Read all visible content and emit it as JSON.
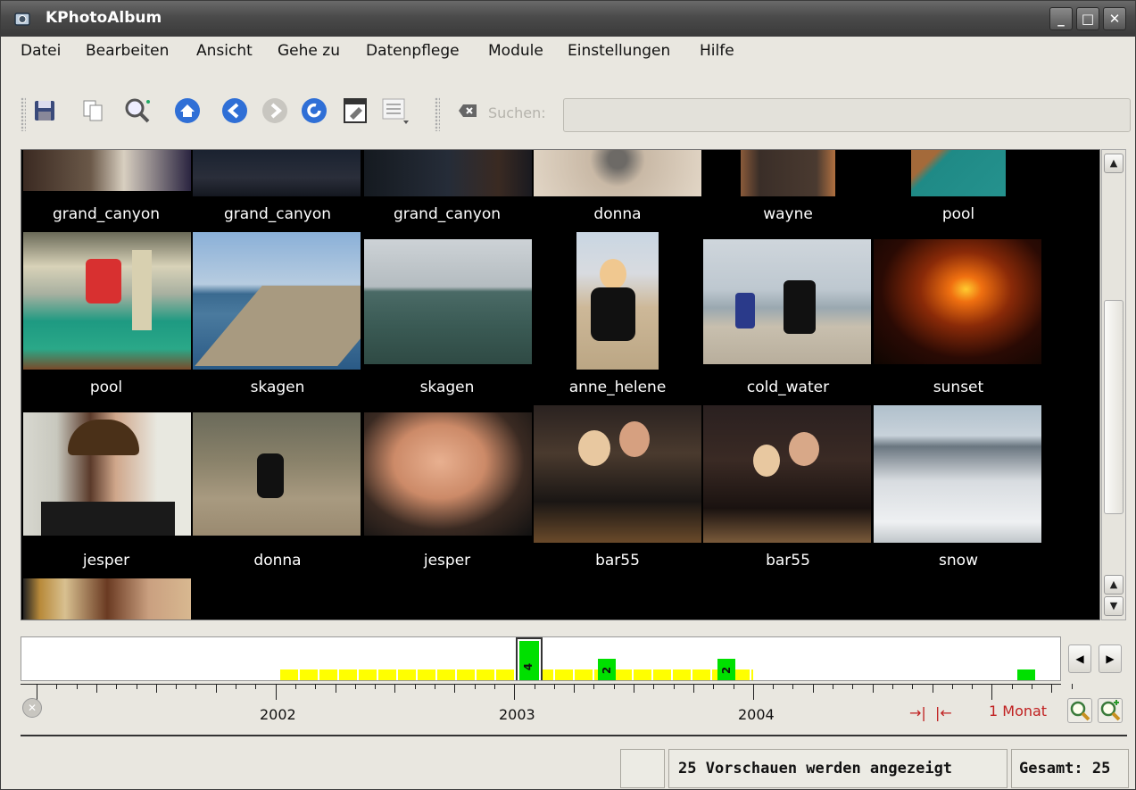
{
  "window": {
    "title": "KPhotoAlbum"
  },
  "menu": [
    "Datei",
    "Bearbeiten",
    "Ansicht",
    "Gehe zu",
    "Datenpflege",
    "Module",
    "Einstellungen",
    "Hilfe"
  ],
  "toolbar": {
    "search_label": "Suchen:",
    "search_value": ""
  },
  "thumbnails": {
    "rows": [
      [
        "grand_canyon",
        "grand_canyon",
        "grand_canyon",
        "donna",
        "wayne",
        "pool"
      ],
      [
        "pool",
        "skagen",
        "skagen",
        "anne_helene",
        "cold_water",
        "sunset"
      ],
      [
        "jesper",
        "donna",
        "jesper",
        "bar55",
        "bar55",
        "snow"
      ]
    ]
  },
  "timeline": {
    "years": [
      "2002",
      "2003",
      "2004"
    ],
    "bar_labels": [
      "4",
      "2",
      "2"
    ],
    "resolution_label": "1 Monat",
    "colors": {
      "range": "#ffff00",
      "count": "#00e000"
    }
  },
  "status": {
    "previews": "25 Vorschauen werden angezeigt",
    "total": "Gesamt: 25"
  }
}
